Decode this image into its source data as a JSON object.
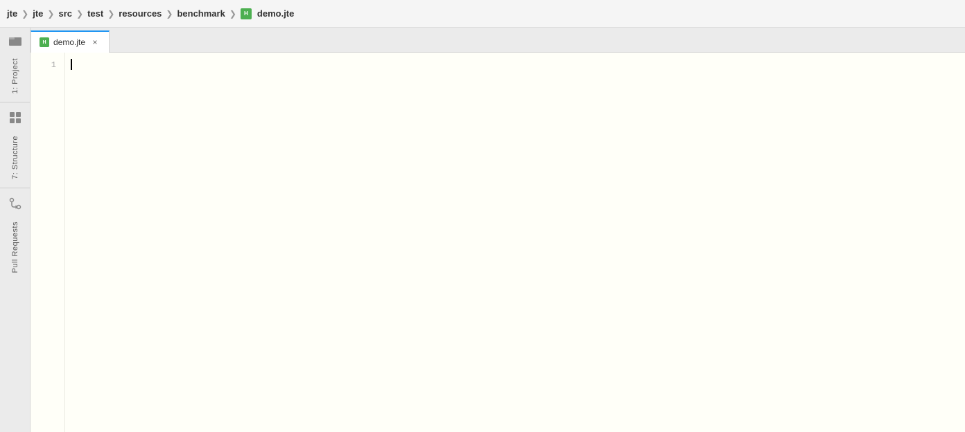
{
  "breadcrumb": {
    "items": [
      {
        "label": "jte",
        "type": "root"
      },
      {
        "label": "jte",
        "type": "module"
      },
      {
        "label": "src",
        "type": "folder"
      },
      {
        "label": "test",
        "type": "folder"
      },
      {
        "label": "resources",
        "type": "folder"
      },
      {
        "label": "benchmark",
        "type": "folder"
      },
      {
        "label": "demo.jte",
        "type": "file",
        "has_icon": true
      }
    ],
    "separator": "❯"
  },
  "tabs": [
    {
      "label": "demo.jte",
      "active": true,
      "has_icon": true,
      "closeable": true,
      "close_symbol": "×"
    }
  ],
  "editor": {
    "lines": [
      {
        "number": "1",
        "content": ""
      }
    ],
    "background_color": "#fffff8"
  },
  "sidebar": {
    "panels": [
      {
        "id": "1-project",
        "label": "1: Project",
        "icon": "folder"
      },
      {
        "id": "7-structure",
        "label": "7: Structure",
        "icon": "structure"
      },
      {
        "id": "pull-requests",
        "label": "Pull Requests",
        "icon": "pull-request"
      }
    ]
  },
  "icons": {
    "folder": "🗂",
    "structure": "⊞",
    "pull_request": "⇄",
    "file_h_label": "H",
    "close": "×"
  }
}
